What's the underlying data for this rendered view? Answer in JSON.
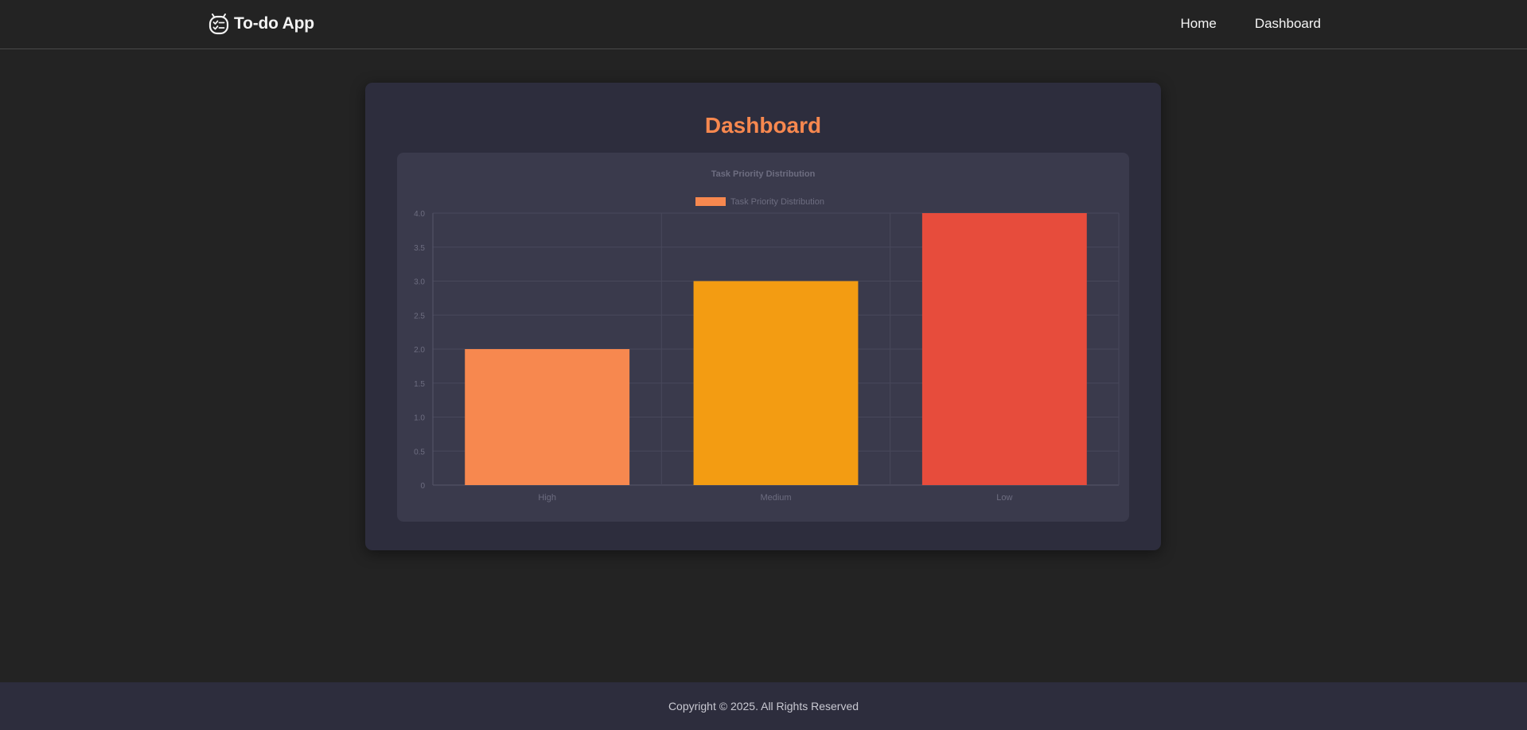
{
  "app": {
    "name": "To-do App",
    "brand_icon": "todo-list-icon"
  },
  "nav": {
    "items": [
      {
        "label": "Home"
      },
      {
        "label": "Dashboard"
      }
    ]
  },
  "main": {
    "title": "Dashboard"
  },
  "chart_data": {
    "type": "bar",
    "title": "Task Priority Distribution",
    "categories": [
      "High",
      "Medium",
      "Low"
    ],
    "series": [
      {
        "name": "Task Priority Distribution",
        "values": [
          2,
          3,
          4
        ],
        "colors": [
          "#f7884f",
          "#f39c12",
          "#e74c3c"
        ]
      }
    ],
    "ylim": [
      0,
      4
    ],
    "yticks": [
      "0",
      "0.5",
      "1.0",
      "1.5",
      "2.0",
      "2.5",
      "3.0",
      "3.5",
      "4.0"
    ],
    "grid": true,
    "legend_position": "top",
    "xlabel": "",
    "ylabel": ""
  },
  "colors": {
    "accent": "#f7884f",
    "page_bg": "#232323",
    "card_bg": "#2d2d3d",
    "panel_bg": "#3a3a4c"
  },
  "footer": {
    "text": "Copyright © 2025. All Rights Reserved"
  }
}
